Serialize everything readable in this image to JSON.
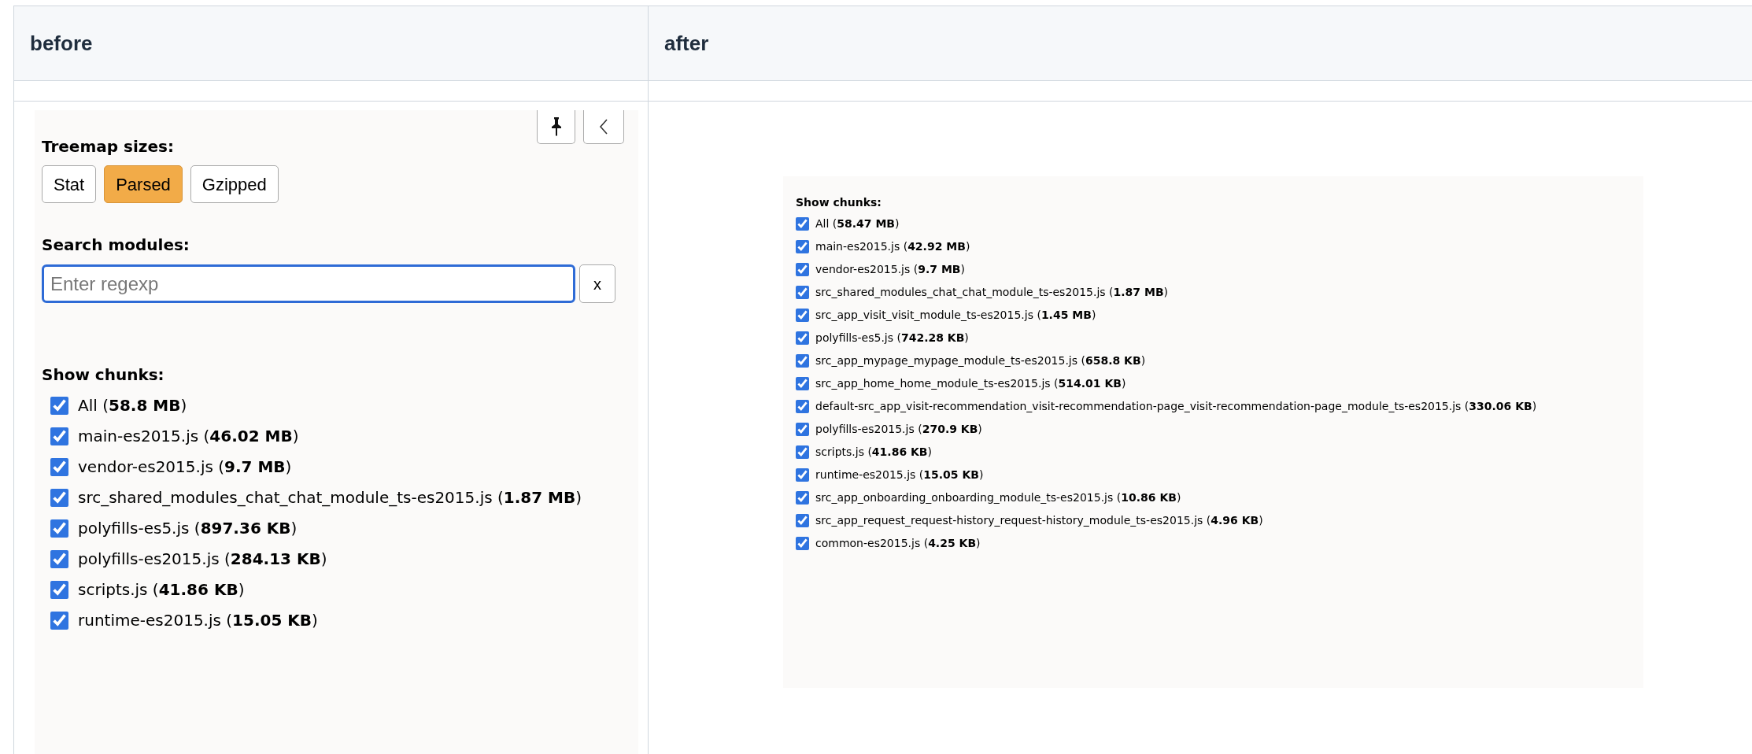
{
  "table": {
    "columns": [
      {
        "label": "before"
      },
      {
        "label": "after"
      }
    ]
  },
  "before": {
    "sizes_label": "Treemap sizes:",
    "size_buttons": [
      {
        "label": "Stat",
        "selected": false
      },
      {
        "label": "Parsed",
        "selected": true
      },
      {
        "label": "Gzipped",
        "selected": false
      }
    ],
    "search_label": "Search modules:",
    "search": {
      "placeholder": "Enter regexp"
    },
    "clear_button": "x",
    "chunks_title": "Show chunks:",
    "chunks": [
      {
        "label": "All (**58.8 MB**)",
        "checked": true
      },
      {
        "label": "main-es2015.js (**46.02 MB**)",
        "checked": true
      },
      {
        "label": "vendor-es2015.js (**9.7 MB**)",
        "checked": true
      },
      {
        "label": "src_shared_modules_chat_chat_module_ts-es2015.js (**1.87 MB**)",
        "checked": true
      },
      {
        "label": "polyfills-es5.js (**897.36 KB**)",
        "checked": true
      },
      {
        "label": "polyfills-es2015.js (**284.13 KB**)",
        "checked": true
      },
      {
        "label": "scripts.js (**41.86 KB**)",
        "checked": true
      },
      {
        "label": "runtime-es2015.js (**15.05 KB**)",
        "checked": true
      }
    ]
  },
  "after": {
    "chunks_title": "Show chunks:",
    "chunks": [
      {
        "label": "All (**58.47 MB**)",
        "checked": true
      },
      {
        "label": "main-es2015.js (**42.92 MB**)",
        "checked": true
      },
      {
        "label": "vendor-es2015.js (**9.7 MB**)",
        "checked": true
      },
      {
        "label": "src_shared_modules_chat_chat_module_ts-es2015.js (**1.87 MB**)",
        "checked": true
      },
      {
        "label": "src_app_visit_visit_module_ts-es2015.js (**1.45 MB**)",
        "checked": true
      },
      {
        "label": "polyfills-es5.js (**742.28 KB**)",
        "checked": true
      },
      {
        "label": "src_app_mypage_mypage_module_ts-es2015.js (**658.8 KB**)",
        "checked": true
      },
      {
        "label": "src_app_home_home_module_ts-es2015.js (**514.01 KB**)",
        "checked": true
      },
      {
        "label": "default-src_app_visit-recommendation_visit-recommendation-page_visit-recommendation-page_module_ts-es2015.js (**330.06 KB**)",
        "checked": true
      },
      {
        "label": "polyfills-es2015.js (**270.9 KB**)",
        "checked": true
      },
      {
        "label": "scripts.js (**41.86 KB**)",
        "checked": true
      },
      {
        "label": "runtime-es2015.js (**15.05 KB**)",
        "checked": true
      },
      {
        "label": "src_app_onboarding_onboarding_module_ts-es2015.js (**10.86 KB**)",
        "checked": true
      },
      {
        "label": "src_app_request_request-history_request-history_module_ts-es2015.js (**4.96 KB**)",
        "checked": true
      },
      {
        "label": "common-es2015.js (**4.25 KB**)",
        "checked": true
      }
    ]
  }
}
